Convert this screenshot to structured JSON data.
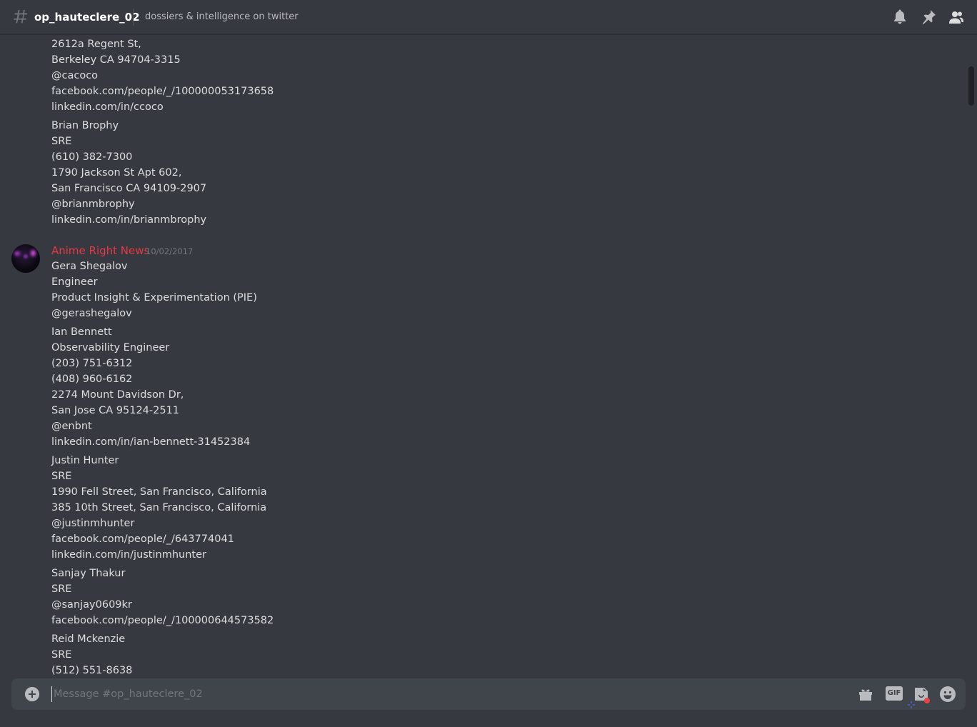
{
  "header": {
    "channel_name": "op_hauteclere_02",
    "topic": "dossiers & intelligence on twitter",
    "icons": [
      "bell-icon",
      "pin-icon",
      "members-icon"
    ]
  },
  "messages": {
    "continued_lines": [
      "2612a Regent St,",
      "Berkeley CA 94704-3315",
      "@cacoco",
      "facebook.com/people/_/100000053173658",
      "linkedin.com/in/ccoco",
      "Brian Brophy",
      "SRE",
      "(610) 382-7300",
      "1790 Jackson St Apt 602,",
      "San Francisco CA 94109-2907",
      "@brianmbrophy",
      "linkedin.com/in/brianmbrophy"
    ],
    "group": {
      "author": "Anime Right News",
      "timestamp": "10/02/2017",
      "lines": [
        "Gera Shegalov",
        "Engineer",
        "Product Insight & Experimentation (PIE)",
        "@gerashegalov",
        "Ian Bennett",
        "Observability Engineer",
        "(203) 751-6312",
        "(408) 960-6162",
        "2274 Mount Davidson Dr,",
        "San Jose CA 95124-2511",
        "@enbnt",
        "linkedin.com/in/ian-bennett-31452384",
        "Justin Hunter",
        "SRE",
        "1990 Fell Street, San Francisco, California",
        "385 10th Street, San Francisco, California",
        "@justinmhunter",
        "facebook.com/people/_/643774041",
        "linkedin.com/in/justinmhunter",
        "Sanjay Thakur",
        "SRE",
        "@sanjay0609kr",
        "facebook.com/people/_/100000644573582",
        "Reid Mckenzie",
        "SRE",
        "(512) 551-8638"
      ]
    }
  },
  "composer": {
    "placeholder": "Message #op_hauteclere_02",
    "value": "",
    "gif_label": "GIF"
  },
  "colors": {
    "background": "#36393f",
    "author": "#e63946",
    "composer": "#40444b"
  }
}
